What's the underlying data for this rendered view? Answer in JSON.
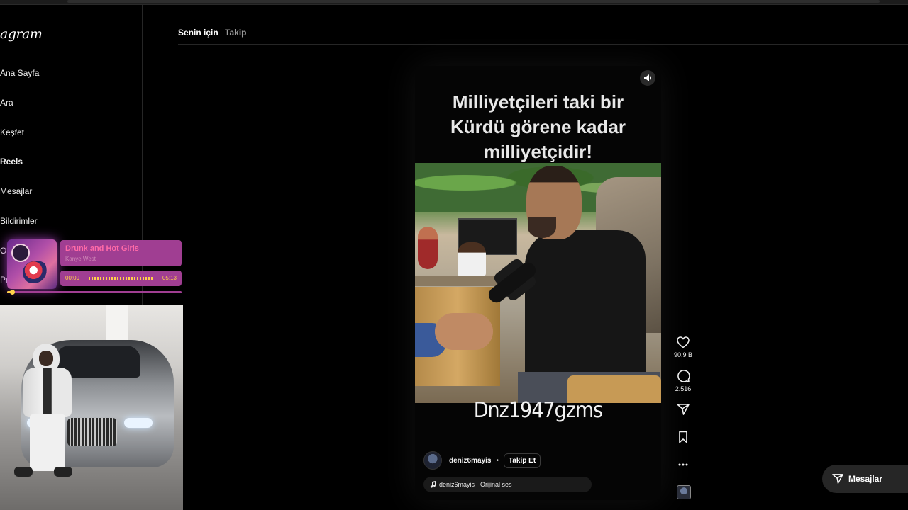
{
  "app": {
    "logo_text": "agram"
  },
  "sidebar": {
    "items": [
      {
        "label": "Ana Sayfa"
      },
      {
        "label": "Ara"
      },
      {
        "label": "Keşfet"
      },
      {
        "label": "Reels"
      },
      {
        "label": "Mesajlar"
      },
      {
        "label": "Bildirimler"
      },
      {
        "label": "Ol"
      },
      {
        "label": "Pro"
      }
    ]
  },
  "music": {
    "title": "Drunk and Hot Girls",
    "artist": "Kanye West",
    "current_time": "00:09",
    "total_time": "05:13",
    "progress_fraction": 0.03
  },
  "feed": {
    "tabs": [
      {
        "label": "Senin için"
      },
      {
        "label": "Takip"
      }
    ]
  },
  "reel": {
    "caption_lines": [
      "Milliyetçileri taki bir",
      "Kürdü görene kadar",
      "milliyetçidir!"
    ],
    "watermark": "Dnz1947gzms",
    "author": "deniz6mayis",
    "separator": "•",
    "follow_label": "Takip Et",
    "audio_text": "deniz6mayis · Orijinal ses"
  },
  "actions": {
    "likes": "90,9 B",
    "comments": "2.516"
  },
  "messages_button": {
    "label": "Mesajlar"
  },
  "icons": {
    "volume": "volume-icon",
    "like": "heart-icon",
    "comment": "comment-icon",
    "share": "send-icon",
    "save": "bookmark-icon",
    "more": "more-icon",
    "music": "music-note-icon",
    "messages": "send-icon"
  },
  "colors": {
    "background": "#000000",
    "music_accent": "#a03e92",
    "music_highlight": "#ffd24a",
    "song_title": "#ff6aa8"
  }
}
